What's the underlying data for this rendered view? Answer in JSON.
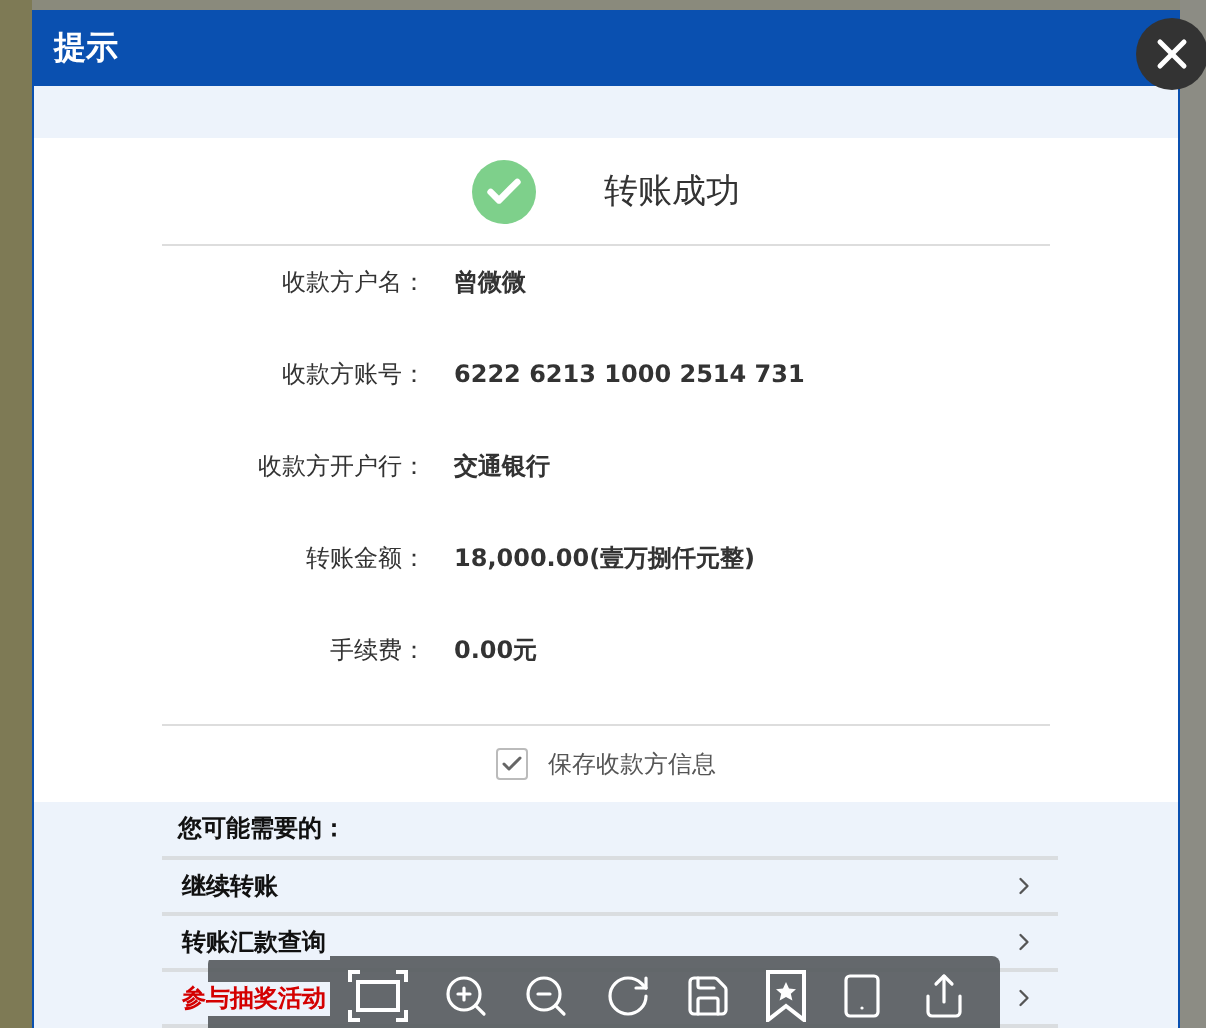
{
  "dialog": {
    "title": "提示"
  },
  "result": {
    "message": "转账成功"
  },
  "details": [
    {
      "label": "收款方户名：",
      "value": "曾微微"
    },
    {
      "label": "收款方账号：",
      "value": "6222 6213 1000 2514 731"
    },
    {
      "label": "收款方开户行：",
      "value": "交通银行"
    },
    {
      "label": "转账金额：",
      "value": "18,000.00(壹万捌仟元整)"
    },
    {
      "label": "手续费：",
      "value": "0.00元"
    }
  ],
  "save_payee": {
    "label": "保存收款方信息",
    "checked": true
  },
  "suggestions": {
    "title": "您可能需要的：",
    "items": [
      {
        "label": "继续转账",
        "highlight": false
      },
      {
        "label": "转账汇款查询",
        "highlight": false
      },
      {
        "label": "参与抽奖活动",
        "highlight": true
      }
    ]
  },
  "viewer_toolbar": {
    "items": [
      {
        "kind": "fit"
      },
      {
        "kind": "zoom_in"
      },
      {
        "kind": "zoom_out"
      },
      {
        "kind": "rotate"
      },
      {
        "kind": "save"
      },
      {
        "kind": "bookmark"
      },
      {
        "kind": "tablet"
      },
      {
        "kind": "share"
      }
    ]
  }
}
